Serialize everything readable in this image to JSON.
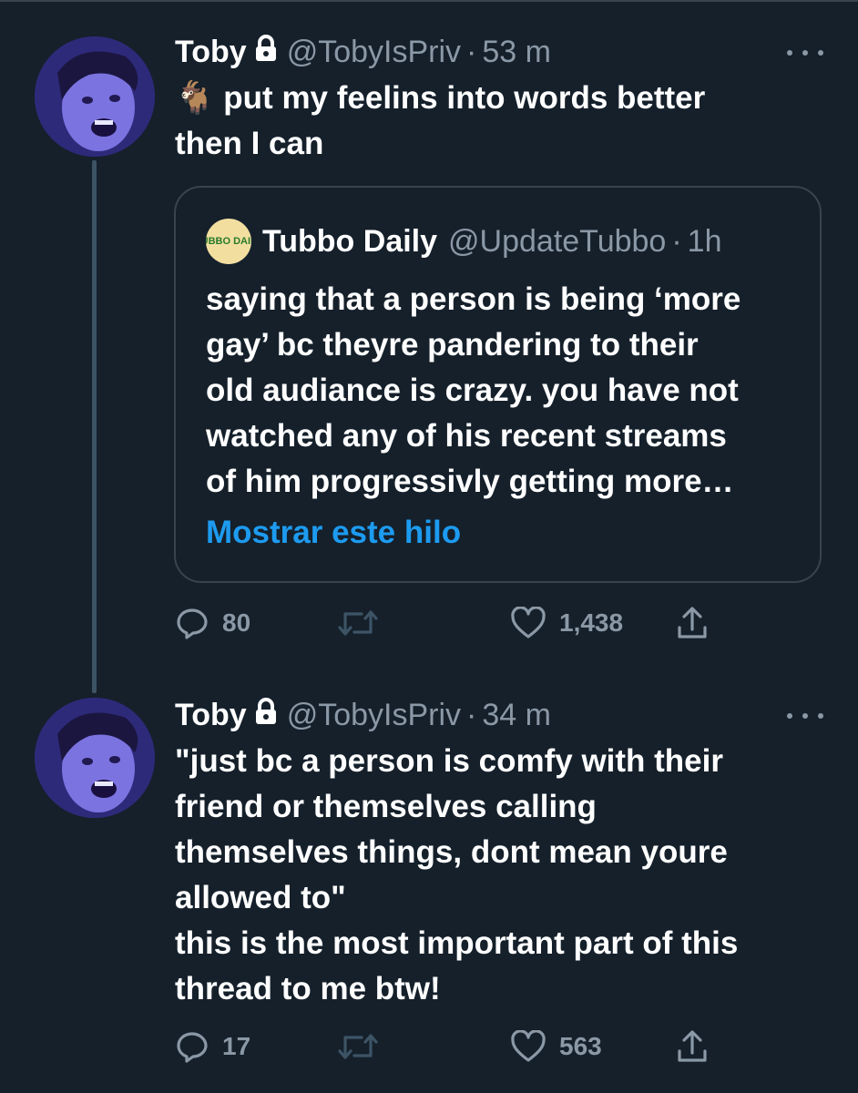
{
  "tweets": [
    {
      "author_name": "Toby",
      "handle": "@TobyIsPriv",
      "separator": "·",
      "time": "53 m",
      "text_lines": [
        "🐐 put my feelins into words better",
        "then I can"
      ],
      "quote": {
        "author_name": "Tubbo Daily",
        "handle": "@UpdateTubbo",
        "separator": "·",
        "time": "1h",
        "avatar_text": "TUBBO DAILY",
        "text_lines": [
          "saying that a person is being ‘more",
          "gay’ bc theyre pandering to their",
          "old audiance is crazy. you have not",
          "watched any of his recent streams",
          "of him progressivly getting more…"
        ],
        "show_thread_link": "Mostrar este hilo"
      },
      "actions": {
        "replies": "80",
        "retweets": "",
        "likes": "1,438"
      }
    },
    {
      "author_name": "Toby",
      "handle": "@TobyIsPriv",
      "separator": "·",
      "time": "34 m",
      "text_lines": [
        "\"just bc a person is comfy with their",
        "friend or themselves calling",
        "themselves things, dont mean youre",
        "allowed to\"",
        "this is the most important part of this",
        "thread to me btw!"
      ],
      "actions": {
        "replies": "17",
        "retweets": "",
        "likes": "563"
      }
    }
  ],
  "colors": {
    "background": "#15202b",
    "text": "#ffffff",
    "secondary": "#8b98a5",
    "link": "#1d9bf0",
    "border": "#38444d"
  },
  "icons": [
    "lock-icon",
    "more-icon",
    "reply-icon",
    "retweet-icon",
    "like-icon",
    "share-icon"
  ]
}
